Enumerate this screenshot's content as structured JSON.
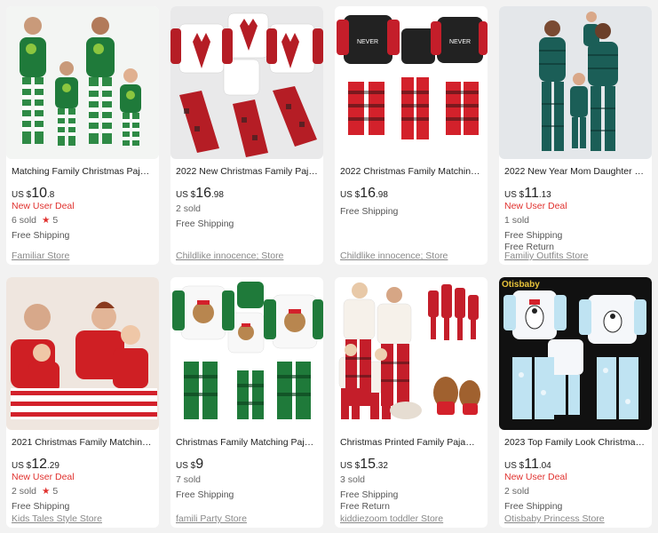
{
  "products": [
    {
      "title": "Matching Family Christmas Pajama...",
      "currency": "US $",
      "price_int": "10",
      "price_dec": ".8",
      "deal": "New User Deal",
      "sold": "6 sold",
      "rating": "5",
      "shipping": "Free Shipping",
      "return": "",
      "store": "Familiar Store"
    },
    {
      "title": "2022 New Christmas Family Pajama...",
      "currency": "US $",
      "price_int": "16",
      "price_dec": ".98",
      "deal": "",
      "sold": "2 sold",
      "rating": "",
      "shipping": "Free Shipping",
      "return": "",
      "store": "Childlike innocence; Store"
    },
    {
      "title": "2022 Christmas Family Matching S...",
      "currency": "US $",
      "price_int": "16",
      "price_dec": ".98",
      "deal": "",
      "sold": "",
      "rating": "",
      "shipping": "Free Shipping",
      "return": "",
      "store": "Childlike innocence; Store"
    },
    {
      "title": "2022 New Year Mom Daughter Da...",
      "currency": "US $",
      "price_int": "11",
      "price_dec": ".13",
      "deal": "New User Deal",
      "sold": "1 sold",
      "rating": "",
      "shipping": "Free Shipping",
      "return": "Free Return",
      "store": "Familiy Outfits Store"
    },
    {
      "title": "2021 Christmas Family Matching L...",
      "currency": "US $",
      "price_int": "12",
      "price_dec": ".29",
      "deal": "New User Deal",
      "sold": "2 sold",
      "rating": "5",
      "shipping": "Free Shipping",
      "return": "",
      "store": "Kids Tales Style Store"
    },
    {
      "title": "Christmas Family Matching Pajam...",
      "currency": "US $",
      "price_int": "9",
      "price_dec": "",
      "deal": "",
      "sold": "7 sold",
      "rating": "",
      "shipping": "Free Shipping",
      "return": "",
      "store": "famili Party Store"
    },
    {
      "title": "Christmas Printed Family Pajamas ...",
      "currency": "US $",
      "price_int": "15",
      "price_dec": ".32",
      "deal": "",
      "sold": "3 sold",
      "rating": "",
      "shipping": "Free Shipping",
      "return": "Free Return",
      "store": "kiddiezoom toddler Store"
    },
    {
      "title": "2023 Top Family Look Christmas Pj...",
      "currency": "US $",
      "price_int": "11",
      "price_dec": ".04",
      "deal": "New User Deal",
      "sold": "2 sold",
      "rating": "",
      "shipping": "Free Shipping",
      "return": "",
      "store": "Otisbaby Princess Store",
      "image_badge": "Otisbaby"
    }
  ],
  "icons": {
    "rating_icon": "star-icon"
  },
  "colors": {
    "deal": "#e0302d",
    "star": "#e0302d",
    "background": "#f2f2f2"
  }
}
